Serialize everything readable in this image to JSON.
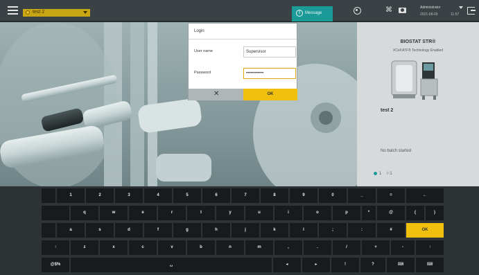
{
  "topbar": {
    "unit_name": "test 2",
    "message_label": "Message",
    "user_name": "Administrator",
    "date": "2021-08-09",
    "time": "11:57"
  },
  "side_panel": {
    "title": "BIOSTAT STR®",
    "subtitle": "XCell ATF® Technology Enabled",
    "unit_name": "test 2",
    "batch_status": "No batch started",
    "status_indicator": "1",
    "status_count": "1"
  },
  "login": {
    "title": "Login",
    "username_label": "User name",
    "username_value": "Supervisor",
    "password_label": "Password",
    "password_value": "••••••••••••",
    "cancel_symbol": "✕",
    "ok_label": "OK"
  },
  "keyboard": {
    "rows": [
      [
        "",
        "1",
        "2",
        "3",
        "4",
        "5",
        "6",
        "7",
        "8",
        "9",
        "0",
        "_",
        "=",
        "←"
      ],
      [
        "",
        "q",
        "w",
        "e",
        "r",
        "t",
        "y",
        "u",
        "i",
        "o",
        "p",
        "*",
        "@",
        "(",
        ")"
      ],
      [
        "",
        "a",
        "s",
        "d",
        "f",
        "g",
        "h",
        "j",
        "k",
        "l",
        ";",
        ":",
        "#",
        "OK"
      ],
      [
        "↑",
        "z",
        "x",
        "c",
        "v",
        "b",
        "n",
        "m",
        ",",
        ".",
        "/",
        "+",
        "-",
        "↑"
      ],
      [
        "@$%",
        "␣",
        "◂",
        "▸",
        "!",
        "?",
        "⌨",
        "⌨"
      ]
    ]
  },
  "colors": {
    "accent_yellow": "#f1c00f",
    "accent_teal": "#1c9a98",
    "keyboard_key": "#171b1c",
    "topbar": "#3a4245"
  }
}
